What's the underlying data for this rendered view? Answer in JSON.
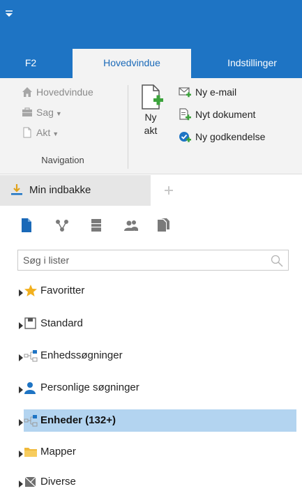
{
  "colors": {
    "accent": "#1e74c4",
    "selection": "#b3d4f0",
    "ribbon_bg": "#f3f3f3"
  },
  "ribbon_tabs": [
    {
      "label": "F2"
    },
    {
      "label": "Hovedvindue",
      "active": true
    },
    {
      "label": "Indstillinger"
    }
  ],
  "navigation_group": {
    "label": "Navigation",
    "items": [
      {
        "label": "Hovedvindue",
        "icon": "home-icon"
      },
      {
        "label": "Sag",
        "icon": "case-icon",
        "dropdown": true
      },
      {
        "label": "Akt",
        "icon": "document-icon",
        "dropdown": true
      }
    ]
  },
  "new_doc_button": {
    "line1": "Ny",
    "line2": "akt"
  },
  "create_items": [
    {
      "label": "Ny e-mail",
      "icon": "new-email-icon"
    },
    {
      "label": "Nyt dokument",
      "icon": "new-document-icon"
    },
    {
      "label": "Ny godkendelse",
      "icon": "new-approval-icon"
    }
  ],
  "document_tabs": [
    {
      "label": "Min indbakke",
      "icon": "inbox-icon"
    }
  ],
  "search": {
    "placeholder": "Søg i lister",
    "value": ""
  },
  "tree": [
    {
      "label": "Favoritter",
      "icon": "star-icon"
    },
    {
      "label": "Standard",
      "icon": "standard-list-icon"
    },
    {
      "label": "Enhedssøgninger",
      "icon": "org-unit-icon"
    },
    {
      "label": "Personlige søgninger",
      "icon": "person-icon"
    },
    {
      "label": "Enheder (132+)",
      "icon": "org-unit-icon",
      "selected": true
    },
    {
      "label": "Mapper",
      "icon": "folder-icon"
    },
    {
      "label": "Diverse",
      "icon": "misc-icon"
    }
  ]
}
